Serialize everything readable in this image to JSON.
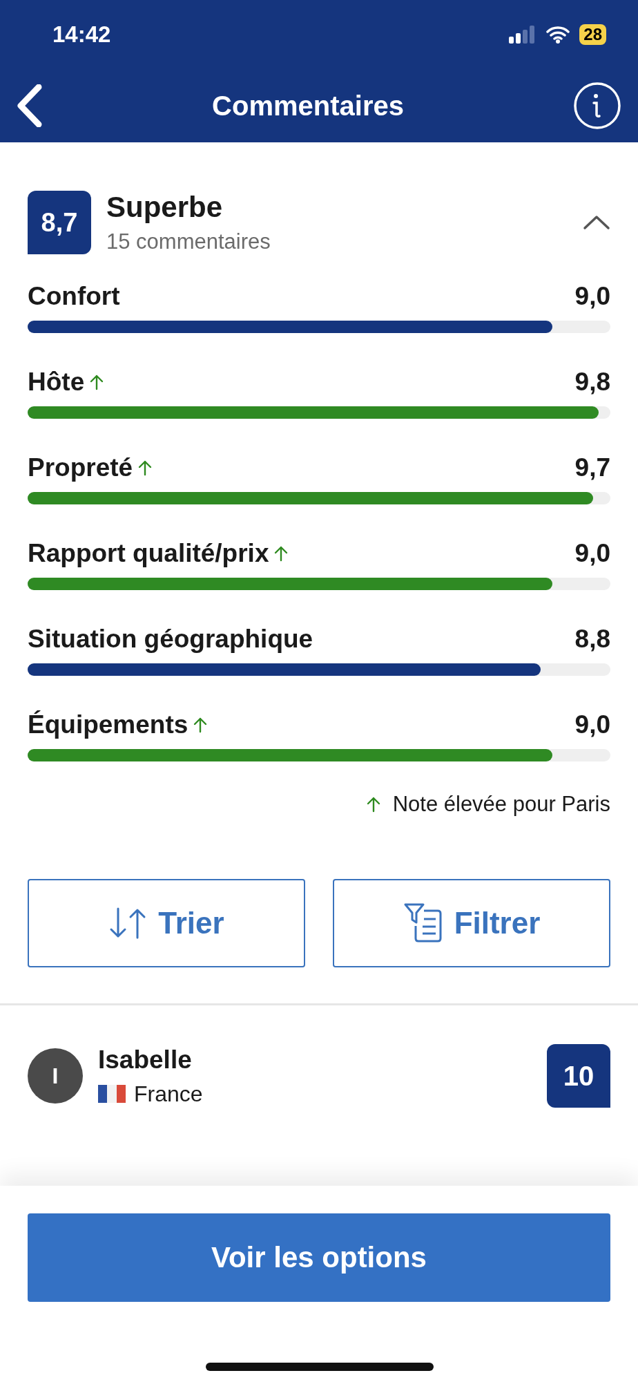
{
  "status_bar": {
    "time": "14:42",
    "battery": "28"
  },
  "header": {
    "title": "Commentaires"
  },
  "summary": {
    "score": "8,7",
    "label": "Superbe",
    "count": "15 commentaires",
    "expanded": true
  },
  "categories": [
    {
      "name": "Confort",
      "score": "9,0",
      "level": 0.9,
      "high_rating": false
    },
    {
      "name": "Hôte",
      "score": "9,8",
      "level": 0.98,
      "high_rating": true
    },
    {
      "name": "Propreté",
      "score": "9,7",
      "level": 0.97,
      "high_rating": true
    },
    {
      "name": "Rapport qualité/prix",
      "score": "9,0",
      "level": 0.9,
      "high_rating": true
    },
    {
      "name": "Situation géographique",
      "score": "8,8",
      "level": 0.88,
      "high_rating": false
    },
    {
      "name": "Équipements",
      "score": "9,0",
      "level": 0.9,
      "high_rating": true
    }
  ],
  "legend": "Note élevée pour Paris",
  "actions": [
    {
      "kind": "sort",
      "label": "Trier"
    },
    {
      "kind": "filter",
      "label": "Filtrer"
    }
  ],
  "review": {
    "initial": "I",
    "name": "Isabelle",
    "country": "France",
    "score": "10"
  },
  "cta": "Voir les options"
}
